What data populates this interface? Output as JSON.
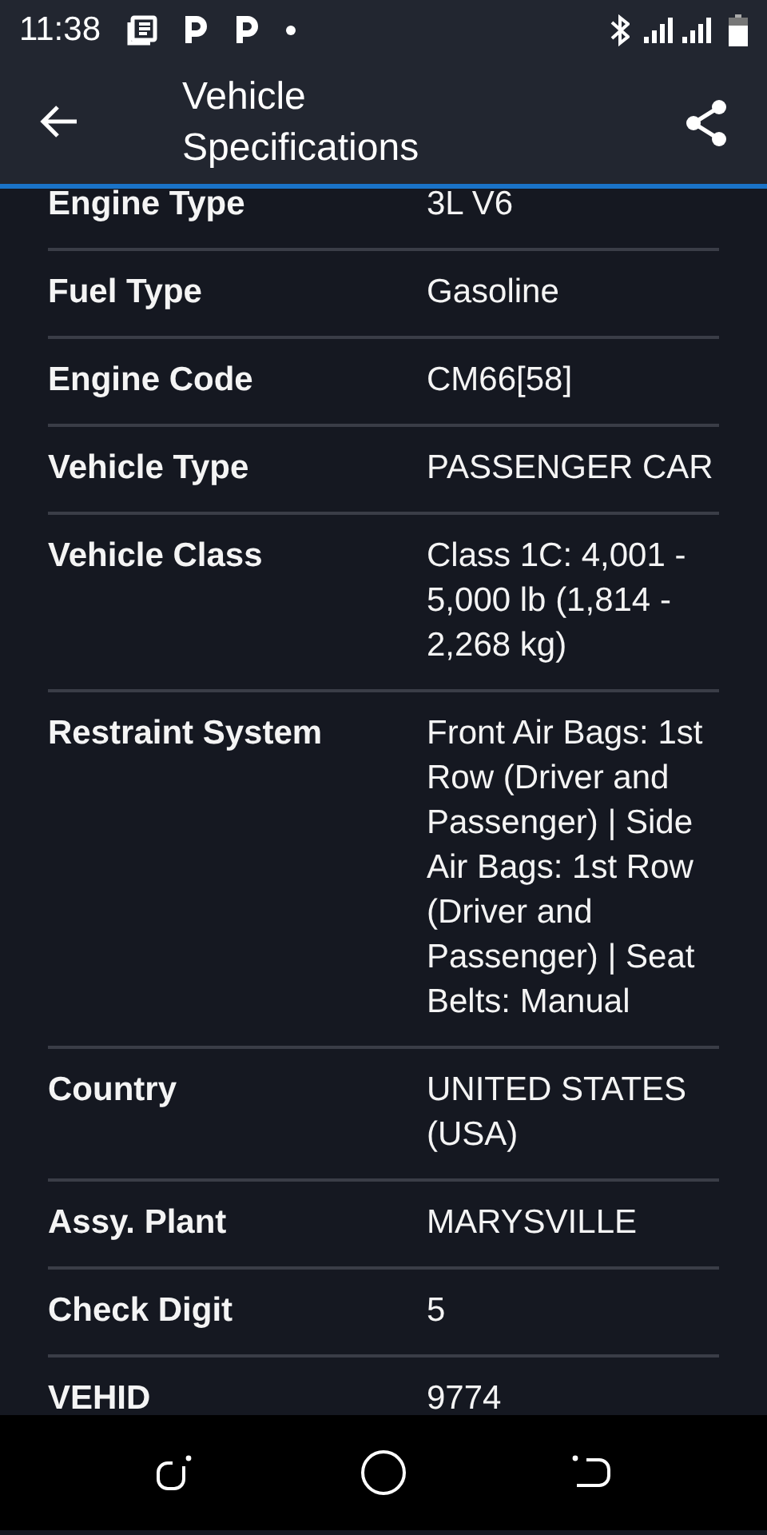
{
  "status_bar": {
    "time": "11:38"
  },
  "app_bar": {
    "title": "Vehicle Specifications"
  },
  "specs": [
    {
      "label": "Engine Type",
      "value": "3L V6"
    },
    {
      "label": "Fuel Type",
      "value": "Gasoline"
    },
    {
      "label": "Engine Code",
      "value": "CM66[58]"
    },
    {
      "label": "Vehicle Type",
      "value": "PASSENGER CAR"
    },
    {
      "label": "Vehicle Class",
      "value": "Class 1C: 4,001 - 5,000 lb (1,814 - 2,268 kg)"
    },
    {
      "label": "Restraint System",
      "value": "Front Air Bags: 1st Row (Driver and Passenger) | Side Air Bags: 1st Row (Driver and Passenger) | Seat Belts: Manual"
    },
    {
      "label": "Country",
      "value": "UNITED STATES (USA)"
    },
    {
      "label": "Assy. Plant",
      "value": "MARYSVILLE"
    },
    {
      "label": "Check Digit",
      "value": "5"
    },
    {
      "label": "VEHID",
      "value": "9774"
    }
  ]
}
